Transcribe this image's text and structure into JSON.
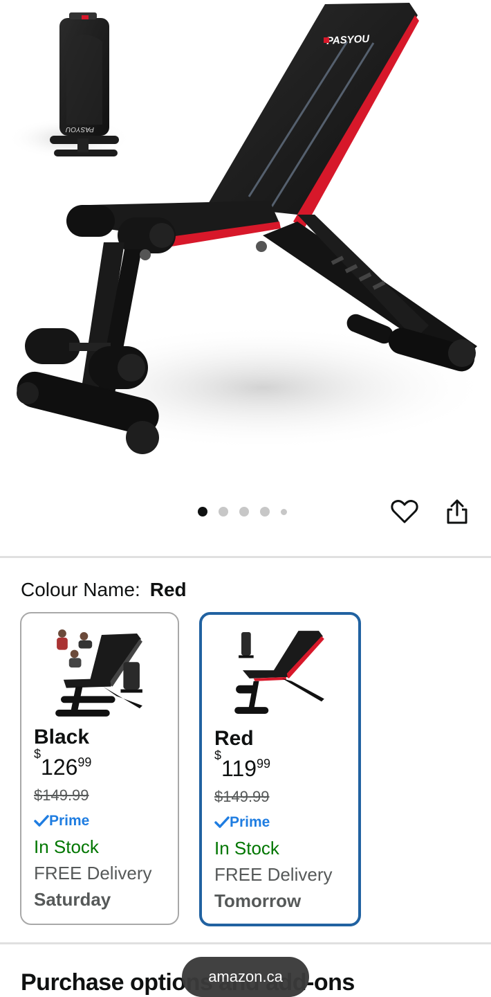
{
  "gallery": {
    "dot_count": 5,
    "active_index": 0,
    "favourite_icon": "heart-outline-icon",
    "share_icon": "share-icon",
    "brand_mark": "PASYOU"
  },
  "colour": {
    "label": "Colour Name:",
    "selected": "Red"
  },
  "variants": [
    {
      "name": "Black",
      "currency": "$",
      "price_whole": "126",
      "price_cents": "99",
      "old_price": "$149.99",
      "prime": "Prime",
      "stock": "In Stock",
      "delivery": "FREE Delivery",
      "day": "Saturday",
      "selected": false
    },
    {
      "name": "Red",
      "currency": "$",
      "price_whole": "119",
      "price_cents": "99",
      "old_price": "$149.99",
      "prime": "Prime",
      "stock": "In Stock",
      "delivery": "FREE Delivery",
      "day": "Tomorrow",
      "selected": true
    }
  ],
  "purchase_section": {
    "title": "Purchase options and add-ons"
  },
  "browser": {
    "domain": "amazon.ca"
  },
  "colors": {
    "accent_blue": "#2162a1",
    "prime_blue": "#1f7de1",
    "stock_green": "#007600",
    "bench_red": "#d7182a"
  }
}
